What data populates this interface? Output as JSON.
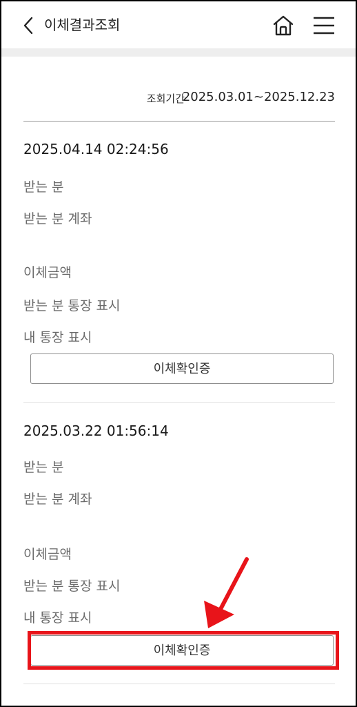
{
  "header": {
    "title": "이체결과조회",
    "back_icon": "chevron-left-icon",
    "home_icon": "home-icon",
    "menu_icon": "hamburger-menu-icon"
  },
  "period": {
    "label": "조회기간",
    "value": "2025.03.01~2025.12.23"
  },
  "records": [
    {
      "datetime": "2025.04.14 02:24:56",
      "fields": [
        "받는 분",
        "받는 분 계좌",
        "이체금액",
        "받는 분 통장 표시",
        "내 통장 표시"
      ],
      "button_label": "이체확인증"
    },
    {
      "datetime": "2025.03.22 01:56:14",
      "fields": [
        "받는 분",
        "받는 분 계좌",
        "이체금액",
        "받는 분 통장 표시",
        "내 통장 표시"
      ],
      "button_label": "이체확인증"
    }
  ],
  "annotation": {
    "highlight_color": "#e8141a"
  }
}
